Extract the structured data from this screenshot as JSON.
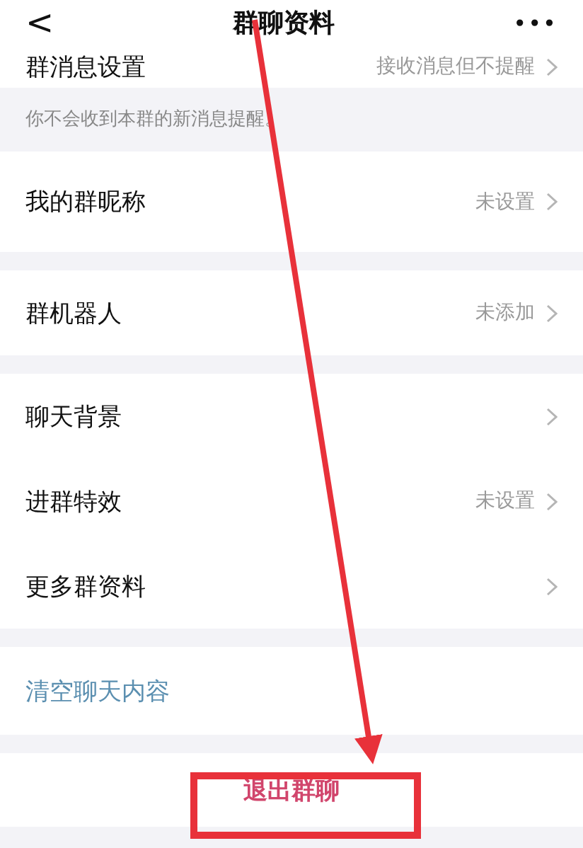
{
  "header": {
    "back": "<",
    "title": "群聊资料",
    "more": "•••"
  },
  "sections": [
    {
      "kind": "group",
      "rows": [
        {
          "label": "群消息设置",
          "value": "接收消息但不提醒"
        }
      ]
    },
    {
      "kind": "note",
      "text": "你不会收到本群的新消息提醒。"
    },
    {
      "kind": "group",
      "rows": [
        {
          "label": "我的群昵称",
          "value": "未设置"
        }
      ]
    },
    {
      "kind": "group",
      "rows": [
        {
          "label": "群机器人",
          "value": "未添加"
        }
      ]
    },
    {
      "kind": "group",
      "rows": [
        {
          "label": "聊天背景"
        },
        {
          "label": "进群特效",
          "value": "未设置"
        },
        {
          "label": "更多群资料"
        }
      ]
    },
    {
      "kind": "link",
      "text": "清空聊天内容"
    },
    {
      "kind": "danger",
      "text": "退出群聊"
    }
  ]
}
